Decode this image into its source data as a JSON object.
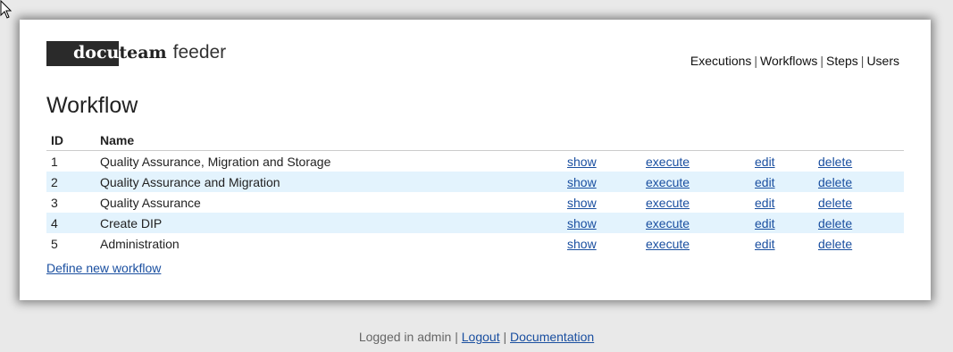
{
  "logo": {
    "part1": "docu",
    "part2": "team",
    "part3": "feeder"
  },
  "nav": [
    {
      "label": "Executions"
    },
    {
      "label": "Workflows"
    },
    {
      "label": "Steps"
    },
    {
      "label": "Users"
    }
  ],
  "page_title": "Workflow",
  "table": {
    "headers": {
      "id": "ID",
      "name": "Name"
    },
    "rows": [
      {
        "id": "1",
        "name": "Quality Assurance, Migration and Storage",
        "show": "show",
        "execute": "execute",
        "edit": "edit",
        "delete": "delete"
      },
      {
        "id": "2",
        "name": "Quality Assurance and Migration",
        "show": "show",
        "execute": "execute",
        "edit": "edit",
        "delete": "delete"
      },
      {
        "id": "3",
        "name": "Quality Assurance",
        "show": "show",
        "execute": "execute",
        "edit": "edit",
        "delete": "delete"
      },
      {
        "id": "4",
        "name": "Create DIP",
        "show": "show",
        "execute": "execute",
        "edit": "edit",
        "delete": "delete"
      },
      {
        "id": "5",
        "name": "Administration",
        "show": "show",
        "execute": "execute",
        "edit": "edit",
        "delete": "delete"
      }
    ]
  },
  "define_link": "Define new workflow",
  "footer": {
    "logged_in": "Logged in admin",
    "logout": "Logout",
    "documentation": "Documentation"
  },
  "colors": {
    "row_alt": "#e3f3fd",
    "link": "#1a4fa0",
    "logo_dark": "#2a2a2a"
  },
  "icons": {
    "cursor": "mouse-pointer-icon"
  }
}
